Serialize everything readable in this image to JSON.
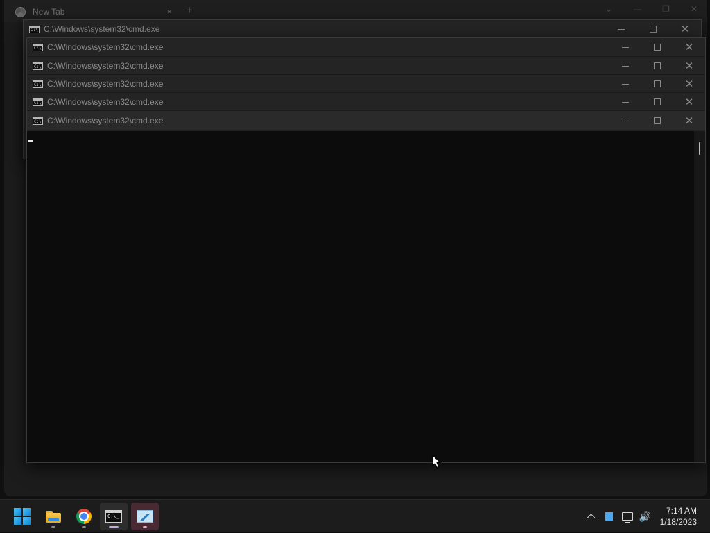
{
  "chrome": {
    "tab_title": "New Tab",
    "tab_close": "×",
    "new_tab": "+"
  },
  "cmd_windows": [
    {
      "title": "C:\\Windows\\system32\\cmd.exe"
    },
    {
      "title": "C:\\Windows\\system32\\cmd.exe"
    },
    {
      "title": "C:\\Windows\\system32\\cmd.exe"
    },
    {
      "title": "C:\\Windows\\system32\\cmd.exe"
    },
    {
      "title": "C:\\Windows\\system32\\cmd.exe"
    },
    {
      "title": "C:\\Windows\\system32\\cmd.exe"
    }
  ],
  "window_controls": {
    "close_glyph": "✕"
  },
  "taskbar": {
    "apps": [
      {
        "icon": "windows-start-icon"
      },
      {
        "icon": "file-explorer-icon"
      },
      {
        "icon": "chrome-icon"
      },
      {
        "icon": "command-prompt-icon"
      },
      {
        "icon": "performance-monitor-icon"
      }
    ],
    "tray": {
      "time": "7:14 AM",
      "date": "1/18/2023",
      "volume_glyph": "🔊"
    }
  },
  "colors": {
    "console_bg": "#0c0c0c",
    "titlebar_bg": "#242424",
    "taskbar_bg": "#1c1c1c",
    "start_accent": "#0a84d6"
  }
}
